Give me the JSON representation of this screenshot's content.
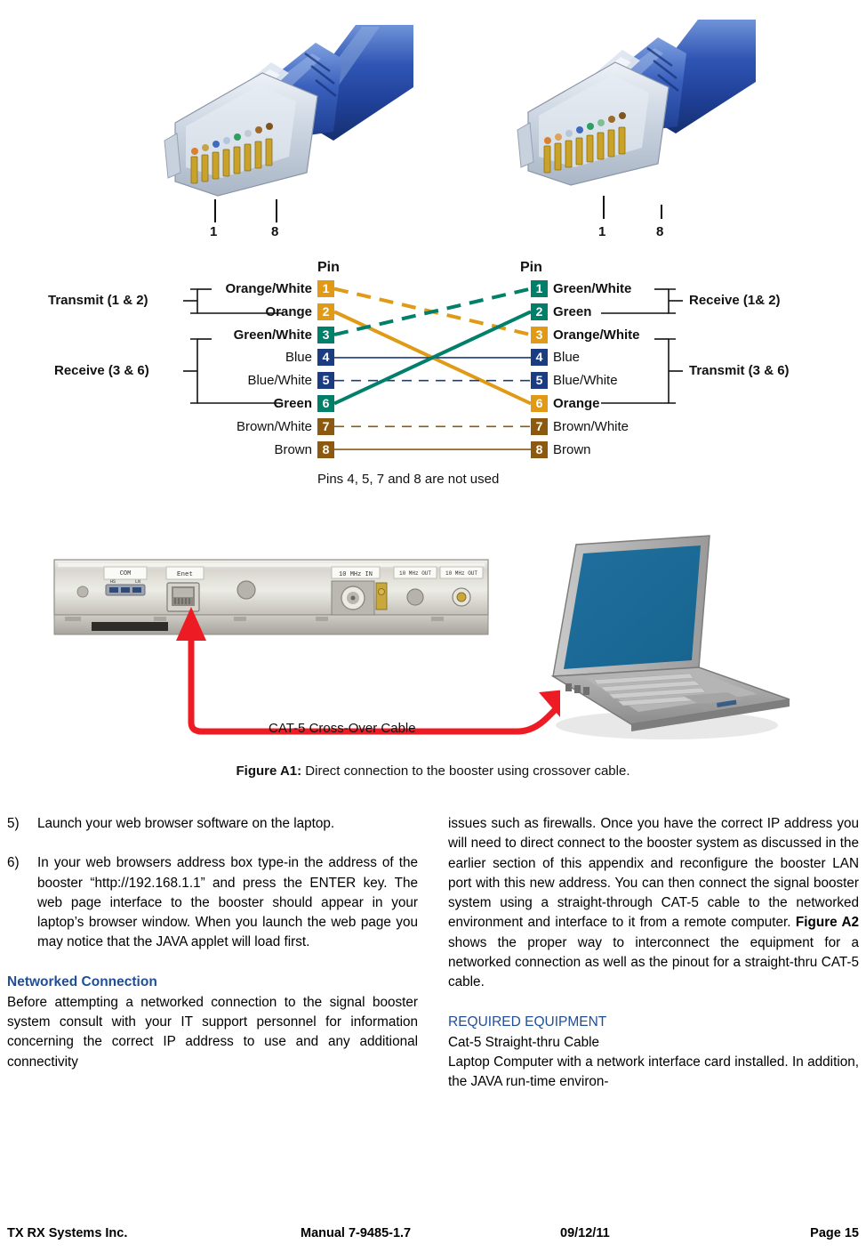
{
  "connectors": {
    "left": {
      "pin_first": "1",
      "pin_last": "8",
      "alt": "rj45-connector-photo"
    },
    "right": {
      "pin_first": "1",
      "pin_last": "8",
      "alt": "rj45-connector-photo"
    }
  },
  "pinout": {
    "header_left": "Pin",
    "header_right": "Pin",
    "note": "Pins 4, 5, 7 and 8 are not used",
    "colors": {
      "orange": "#E09A15",
      "green": "#00806A",
      "blue": "#1B3C80",
      "brown": "#8B5A10"
    },
    "left_groups": [
      {
        "label": "Transmit (1 & 2)",
        "pins": [
          1,
          2
        ]
      },
      {
        "label": "Receive (3 & 6)",
        "pins": [
          3,
          6
        ]
      }
    ],
    "right_groups": [
      {
        "label": "Receive (1& 2)",
        "pins": [
          1,
          2
        ]
      },
      {
        "label": "Transmit (3 & 6)",
        "pins": [
          3,
          6
        ]
      }
    ],
    "left_pins": [
      {
        "num": "1",
        "label": "Orange/White",
        "color": "orange",
        "bold": true
      },
      {
        "num": "2",
        "label": "Orange",
        "color": "orange",
        "bold": true
      },
      {
        "num": "3",
        "label": "Green/White",
        "color": "green",
        "bold": true
      },
      {
        "num": "4",
        "label": "Blue",
        "color": "blue",
        "bold": false
      },
      {
        "num": "5",
        "label": "Blue/White",
        "color": "blue",
        "bold": false
      },
      {
        "num": "6",
        "label": "Green",
        "color": "green",
        "bold": true
      },
      {
        "num": "7",
        "label": "Brown/White",
        "color": "brown",
        "bold": false
      },
      {
        "num": "8",
        "label": "Brown",
        "color": "brown",
        "bold": false
      }
    ],
    "right_pins": [
      {
        "num": "1",
        "label": "Green/White",
        "color": "green",
        "bold": true
      },
      {
        "num": "2",
        "label": "Green",
        "color": "green",
        "bold": true
      },
      {
        "num": "3",
        "label": "Orange/White",
        "color": "orange",
        "bold": true
      },
      {
        "num": "4",
        "label": "Blue",
        "color": "blue",
        "bold": false
      },
      {
        "num": "5",
        "label": "Blue/White",
        "color": "blue",
        "bold": false
      },
      {
        "num": "6",
        "label": "Orange",
        "color": "orange",
        "bold": true
      },
      {
        "num": "7",
        "label": "Brown/White",
        "color": "brown",
        "bold": false
      },
      {
        "num": "8",
        "label": "Brown",
        "color": "brown",
        "bold": false
      }
    ],
    "connections": [
      {
        "from": 1,
        "to": 3,
        "color": "orange",
        "style": "dashed"
      },
      {
        "from": 2,
        "to": 6,
        "color": "orange",
        "style": "solid"
      },
      {
        "from": 3,
        "to": 1,
        "color": "green",
        "style": "dashed"
      },
      {
        "from": 4,
        "to": 4,
        "color": "blue",
        "style": "solid"
      },
      {
        "from": 5,
        "to": 5,
        "color": "blue",
        "style": "dashed"
      },
      {
        "from": 6,
        "to": 2,
        "color": "green",
        "style": "solid"
      },
      {
        "from": 7,
        "to": 7,
        "color": "brown",
        "style": "dashed"
      },
      {
        "from": 8,
        "to": 8,
        "color": "brown",
        "style": "solid"
      }
    ]
  },
  "figure": {
    "cable_label": "CAT-5 Cross-Over Cable",
    "caption_prefix": "Figure A1:",
    "caption_text": "Direct connection to the booster using crossover cable.",
    "arrow_color": "#ED1C24",
    "panel_labels": {
      "com": "COM",
      "com_sub_left": "HS",
      "com_sub_right": "LN",
      "enet": "Enet",
      "ten_mhz_in": "10 MHz IN",
      "ten_mhz_out_1": "10 MHz OUT",
      "ten_mhz_out_2": "10 MHz OUT"
    }
  },
  "body": {
    "left": {
      "item5_marker": "5)",
      "item5_text": "Launch your web browser software on the laptop.",
      "item6_marker": "6)",
      "item6_text": "In your web browsers address box type-in the address of the booster “http://192.168.1.1” and press the ENTER key. The web page interface to the booster should appear in your laptop’s browser window. When you launch the web page you may notice that the JAVA applet will load first.",
      "heading": "Networked Connection",
      "paragraph": "Before attempting a networked connection to the signal booster system consult with your IT support personnel for information concerning the correct IP address to use and any additional connectivity"
    },
    "right": {
      "paragraph_part1": "issues such as firewalls. Once you have the correct IP address you will need to direct connect to the booster system as discussed in the earlier section of this appendix and reconfigure the booster LAN port with this new address. You can then connect the signal booster system using a straight-through CAT-5 cable to the networked environment and interface to it from a remote computer. ",
      "figure_ref": "Figure A2",
      "paragraph_part2": " shows the proper way to interconnect the equipment for a networked connection as well as the pinout for a straight-thru CAT-5 cable.",
      "heading": "REQUIRED EQUIPMENT",
      "equipment_line1": "Cat-5 Straight-thru Cable",
      "equipment_line2": "Laptop Computer with a network interface card installed. In addition, the JAVA run-time environ-"
    }
  },
  "footer": {
    "company": "TX RX Systems Inc.",
    "manual": "Manual 7-9485-1.7",
    "date": "09/12/11",
    "page": "Page 15"
  }
}
